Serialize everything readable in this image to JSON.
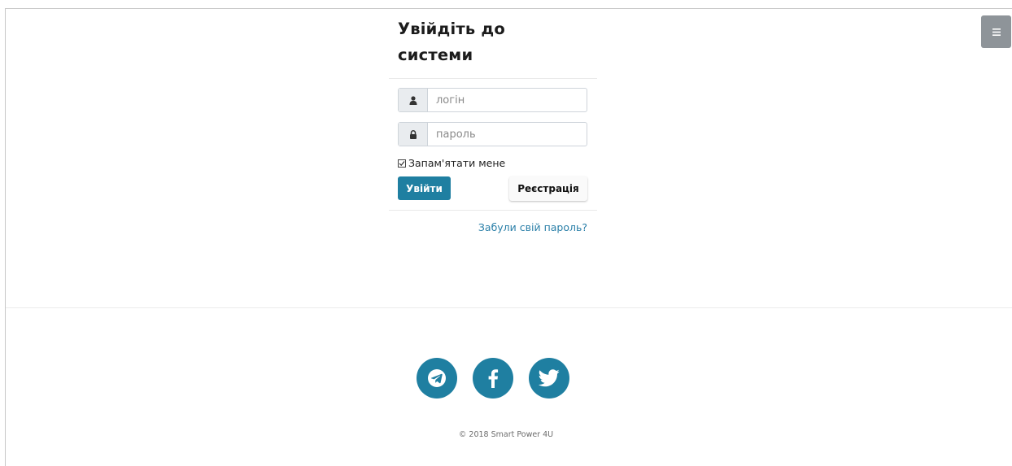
{
  "menu": {
    "icon": "hamburger-menu-icon"
  },
  "login": {
    "title_line1": "Увійдіть до",
    "title_line2": "системи",
    "username_placeholder": "логін",
    "username_icon": "user-icon",
    "password_placeholder": "пароль",
    "password_icon": "lock-icon",
    "remember_label": "Запам'ятати мене",
    "remember_checked": true,
    "submit_label": "Увійти",
    "register_label": "Реєстрація",
    "forgot_label": "Забули свій пароль?"
  },
  "footer": {
    "social": [
      {
        "icon": "telegram-icon"
      },
      {
        "icon": "facebook-icon"
      },
      {
        "icon": "twitter-icon"
      }
    ],
    "copyright": "© 2018 Smart Power 4U"
  },
  "colors": {
    "accent": "#1f7fa1",
    "menu_button": "#8e9499",
    "link": "#2a7fa8"
  }
}
